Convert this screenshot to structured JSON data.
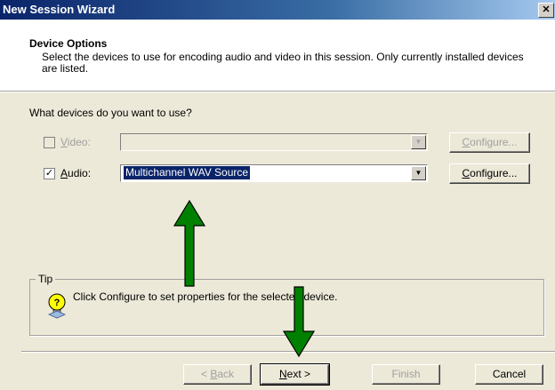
{
  "window": {
    "title": "New Session Wizard",
    "close_glyph": "✕"
  },
  "header": {
    "title": "Device Options",
    "description": "Select the devices to use for encoding audio and video in this session. Only currently installed devices are listed."
  },
  "question": "What devices do you want to use?",
  "video": {
    "label_first": "V",
    "label_rest": "ideo:",
    "checked": false,
    "value": "",
    "configure_first": "C",
    "configure_rest": "onfigure..."
  },
  "audio": {
    "label_first": "A",
    "label_rest": "udio:",
    "checked": true,
    "check_glyph": "✓",
    "value": "Multichannel WAV Source",
    "configure_first": "C",
    "configure_rest": "onfigure..."
  },
  "tip": {
    "legend": "Tip",
    "text": "Click Configure to set properties for the selected device.",
    "icon": "lightbulb-icon"
  },
  "buttons": {
    "back_prefix": "< ",
    "back_u": "B",
    "back_rest": "ack",
    "next_u": "N",
    "next_rest": "ext >",
    "finish": "Finish",
    "cancel": "Cancel"
  },
  "annotations": {
    "arrow_color": "#008000"
  },
  "colors": {
    "titlebar": "#0a246a",
    "dialog_bg": "#ece9d8",
    "selection": "#0a246a"
  }
}
